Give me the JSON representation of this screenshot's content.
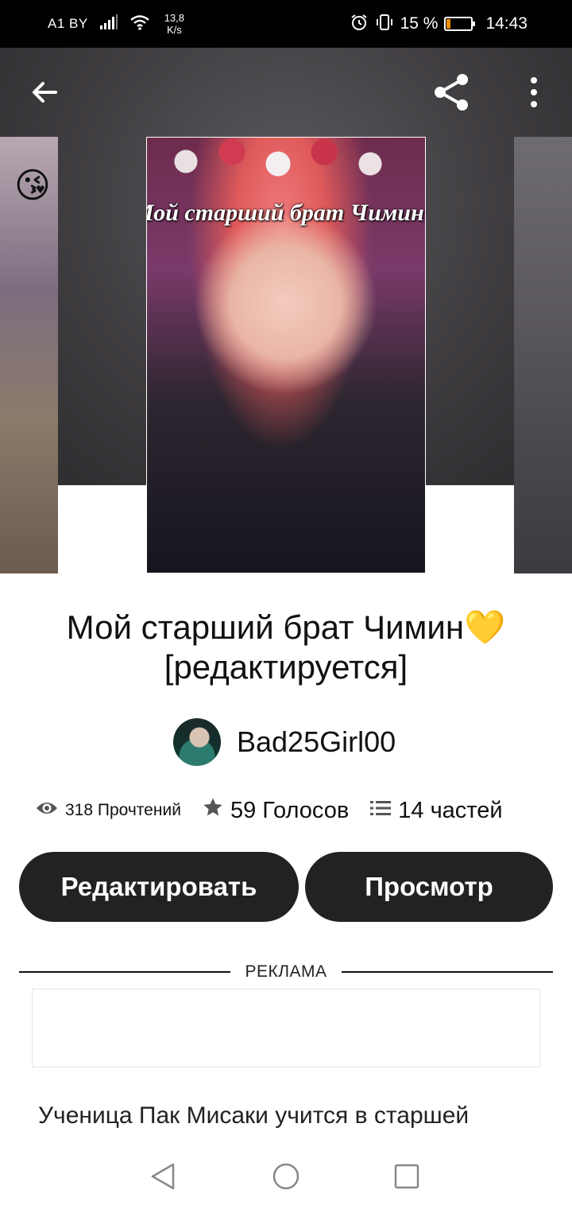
{
  "status_bar": {
    "carrier": "A1 BY",
    "net_speed_value": "13,8",
    "net_speed_unit": "K/s",
    "battery_percent": "15 %",
    "battery_level": 0.15,
    "time": "14:43"
  },
  "toolbar": {
    "back_icon": "arrow-left-icon",
    "share_icon": "share-icon",
    "menu_icon": "more-vertical-icon"
  },
  "cover": {
    "overlay_text": "Мой старший брат Чимин"
  },
  "story": {
    "title_line1": "Мой старший брат Чимин💛",
    "title_line2": "[редактируется]",
    "author": "Bad25Girl00",
    "reads": "318 Прочтений",
    "votes": "59 Голосов",
    "parts": "14 частей",
    "description": "Ученица Пак Мисаки учится в старшей"
  },
  "actions": {
    "edit_label": "Редактировать",
    "view_label": "Просмотр"
  },
  "ad": {
    "label": "РЕКЛАМА"
  },
  "colors": {
    "button_bg": "#222124",
    "battery_low": "#f08c00"
  }
}
